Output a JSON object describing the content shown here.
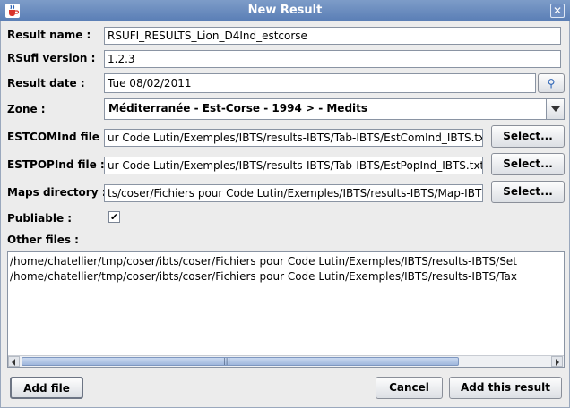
{
  "window": {
    "title": "New Result",
    "close_glyph": "✕",
    "app_icon": "java-cup-icon"
  },
  "form": {
    "result_name": {
      "label": "Result name :",
      "value": "RSUFI_RESULTS_Lion_D4Ind_estcorse"
    },
    "rsufi_version": {
      "label": "RSufi version :",
      "value": "1.2.3"
    },
    "result_date": {
      "label": "Result date :",
      "value": "Tue 08/02/2011",
      "button_icon": "calendar-icon",
      "button_glyph": "⚲"
    },
    "zone": {
      "label": "Zone :",
      "value": "Méditerranée - Est-Corse - 1994 > - Medits"
    },
    "estcomind_file": {
      "label": "ESTCOMInd file :",
      "value": "ur Code Lutin/Exemples/IBTS/results-IBTS/Tab-IBTS/EstComInd_IBTS.txt",
      "button": "Select..."
    },
    "estpopind_file": {
      "label": "ESTPOPInd file :",
      "value": "ur Code Lutin/Exemples/IBTS/results-IBTS/Tab-IBTS/EstPopInd_IBTS.txt",
      "button": "Select..."
    },
    "maps_directory": {
      "label": "Maps directory :",
      "value": "ts/coser/Fichiers pour Code Lutin/Exemples/IBTS/results-IBTS/Map-IBTS",
      "button": "Select..."
    },
    "publiable": {
      "label": "Publiable :",
      "checked_glyph": "✔"
    },
    "other_files": {
      "label": "Other files :",
      "lines": [
        "/home/chatellier/tmp/coser/ibts/coser/Fichiers pour Code Lutin/Exemples/IBTS/results-IBTS/Set",
        "/home/chatellier/tmp/coser/ibts/coser/Fichiers pour Code Lutin/Exemples/IBTS/results-IBTS/Tax"
      ],
      "scroll_grip": "|||"
    }
  },
  "buttons": {
    "add_file": "Add file",
    "cancel": "Cancel",
    "add_result": "Add this result"
  }
}
